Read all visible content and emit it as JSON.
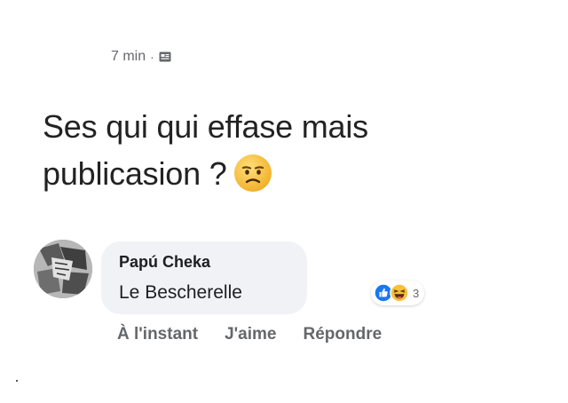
{
  "post": {
    "timestamp": "7 min",
    "separator": "·",
    "audience_icon": "audience-icon",
    "text": "Ses qui qui effase mais publicasion ?",
    "emoji": "frowning-face-emoji"
  },
  "comment": {
    "author": "Papú Cheka",
    "text": "Le Bescherelle",
    "reactions": {
      "icons": [
        "like-reaction-icon",
        "haha-reaction-icon"
      ],
      "count": "3"
    },
    "actions": {
      "time": "À l'instant",
      "like": "J'aime",
      "reply": "Répondre"
    }
  },
  "colors": {
    "bubble": "#f0f2f5",
    "secondary_text": "#65676b",
    "like_blue": "#1877f2",
    "emoji_yellow": "#f7c13b"
  }
}
